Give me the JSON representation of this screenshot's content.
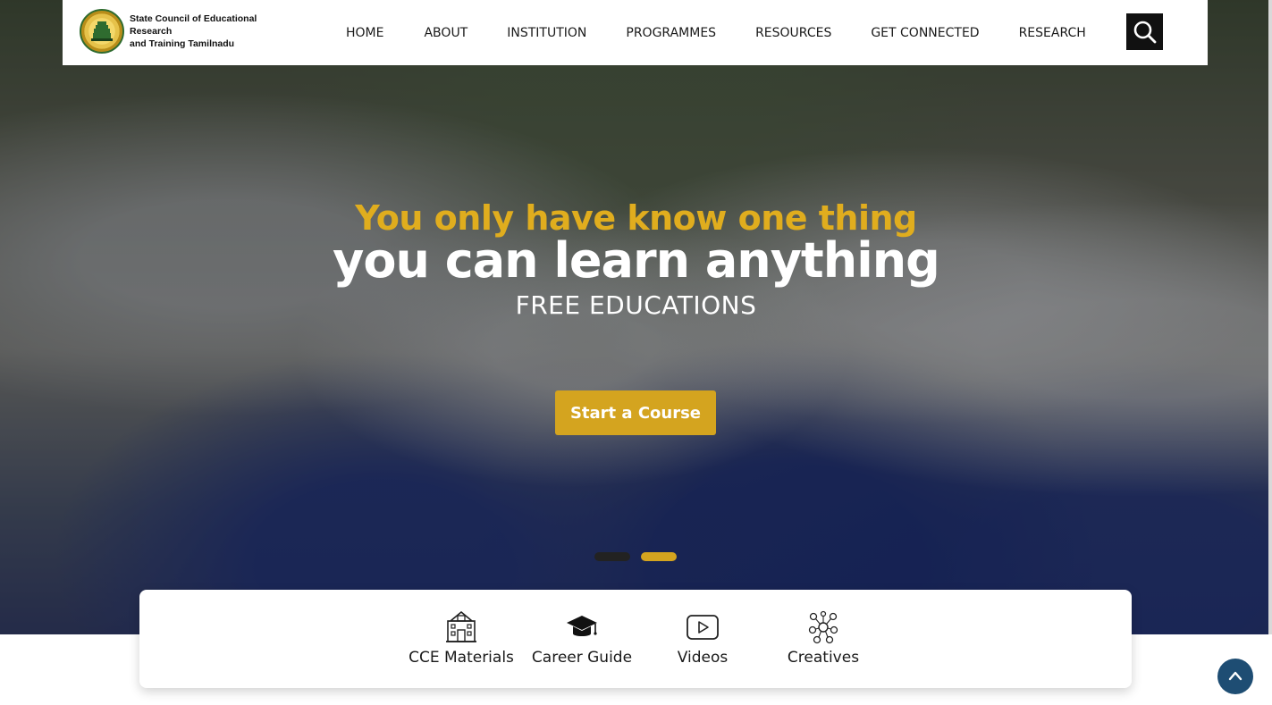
{
  "header": {
    "logo_line1": "State Council of Educational Research",
    "logo_line2": "and Training Tamilnadu",
    "nav": [
      "HOME",
      "ABOUT",
      "INSTITUTION",
      "PROGRAMMES",
      "RESOURCES",
      "GET CONNECTED",
      "RESEARCH"
    ],
    "search_icon": "search-icon"
  },
  "hero": {
    "headline_top": "You only have know one thing",
    "headline_main": "you can learn anything",
    "subheading": "FREE EDUCATIONS",
    "cta_label": "Start a Course",
    "slides_total": 2,
    "slide_active": 2
  },
  "quick_links": [
    {
      "label": "CCE Materials",
      "icon": "school-building-icon"
    },
    {
      "label": "Career Guide",
      "icon": "graduation-cap-icon"
    },
    {
      "label": "Videos",
      "icon": "play-video-icon"
    },
    {
      "label": "Creatives",
      "icon": "network-people-icon"
    }
  ],
  "scroll_top_icon": "chevron-up-icon",
  "colors": {
    "accent_gold": "#d4a41f",
    "headline_gold": "#e0ad1e",
    "scroll_button": "#1e4d73",
    "nav_search_bg": "#111111"
  }
}
